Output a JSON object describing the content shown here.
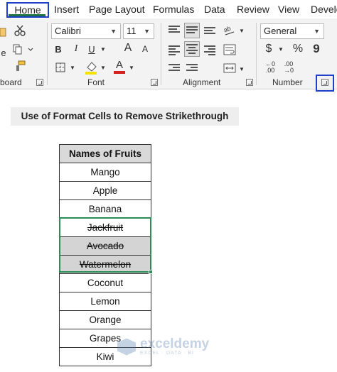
{
  "tabs": {
    "home": "Home",
    "insert": "Insert",
    "page_layout": "Page Layout",
    "formulas": "Formulas",
    "data": "Data",
    "review": "Review",
    "view": "View",
    "developer": "Develo"
  },
  "ribbon": {
    "clipboard": {
      "label": "board",
      "paste_fragment": "e"
    },
    "font": {
      "label": "Font",
      "name": "Calibri",
      "size": "11",
      "bold": "B",
      "italic": "I",
      "underline": "U",
      "grow": "A",
      "shrink": "A",
      "color_letter": "A"
    },
    "alignment": {
      "label": "Alignment"
    },
    "number": {
      "label": "Number",
      "format": "General",
      "currency": "$",
      "percent": "%",
      "comma": "9",
      "inc_decimal": "←0 .00",
      "dec_decimal": ".00 →0"
    }
  },
  "sheet": {
    "title": "Use of Format Cells to Remove Strikethrough",
    "header": "Names of Fruits",
    "rows": [
      "Mango",
      "Apple",
      "Banana",
      "Jackfruit",
      "Avocado",
      "Watermelon",
      "Coconut",
      "Lemon",
      "Orange",
      "Grapes",
      "Kiwi"
    ]
  },
  "watermark": {
    "name": "exceldemy",
    "tagline": "EXCEL · DATA · BI"
  },
  "colors": {
    "highlight": "#1f3fc8",
    "selection": "#2e8b57",
    "font_color_bar": "#d32020"
  }
}
